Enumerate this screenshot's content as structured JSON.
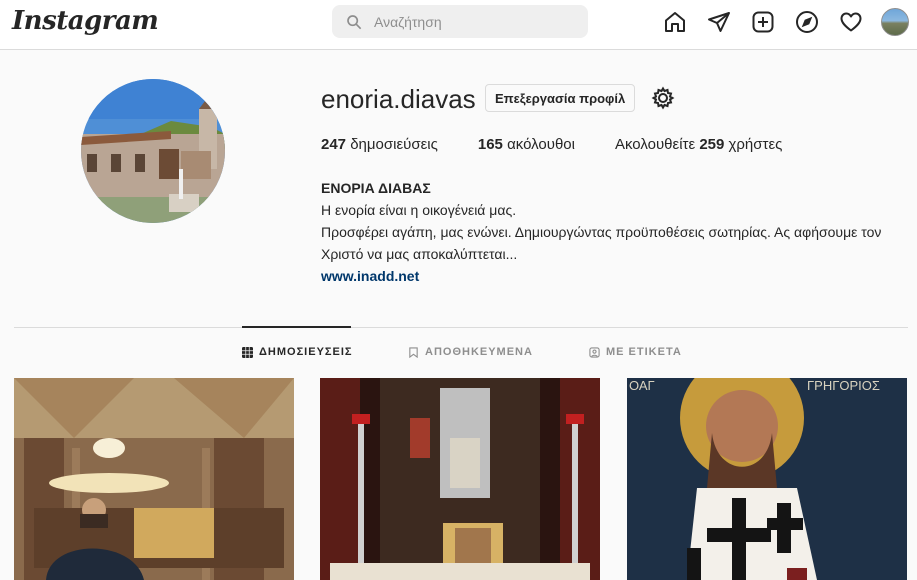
{
  "nav": {
    "logo": "Instagram",
    "search_placeholder": "Αναζήτηση",
    "icons": [
      "home-icon",
      "direct-icon",
      "new-post-icon",
      "explore-icon",
      "activity-heart-icon",
      "profile-avatar"
    ]
  },
  "profile": {
    "username": "enoria.diavas",
    "edit_label": "Επεξεργασία προφίλ",
    "stats": {
      "posts_count": "247",
      "posts_label": "δημοσιεύσεις",
      "followers_count": "165",
      "followers_label": "ακόλουθοι",
      "following_prefix": "Ακολουθείτε",
      "following_count": "259",
      "following_suffix": "χρήστες"
    },
    "bio": {
      "name": "ΕΝΟΡΙΑ ΔΙΑΒΑΣ",
      "line1": "Η ενορία είναι η οικογένειά μας.",
      "line2": "Προσφέρει αγάπη, μας ενώνει. Δημιουργώντας προϋποθέσεις σωτηρίας. Ας αφήσουμε τον Χριστό να μας αποκαλύπτεται...",
      "link": "www.inadd.net"
    }
  },
  "tabs": [
    {
      "label": "ΔΗΜΟΣΙΕΥΣΕΙΣ",
      "active": true
    },
    {
      "label": "ΑΠΟΘΗΚΕΥΜΕΝΑ",
      "active": false
    },
    {
      "label": "ΜΕ ΕΤΙΚΕΤΑ",
      "active": false
    }
  ],
  "posts": [
    {
      "alt": "church-interior-post"
    },
    {
      "alt": "altar-post"
    },
    {
      "alt": "icon-post",
      "icon_text_left": "ΟΑΓ",
      "icon_text_right": "ΓΡΗΓΟΡΙΟΣ"
    }
  ],
  "colors": {
    "link": "#00376b",
    "text": "#262626",
    "muted": "#8e8e8e",
    "border": "#dbdbdb"
  }
}
